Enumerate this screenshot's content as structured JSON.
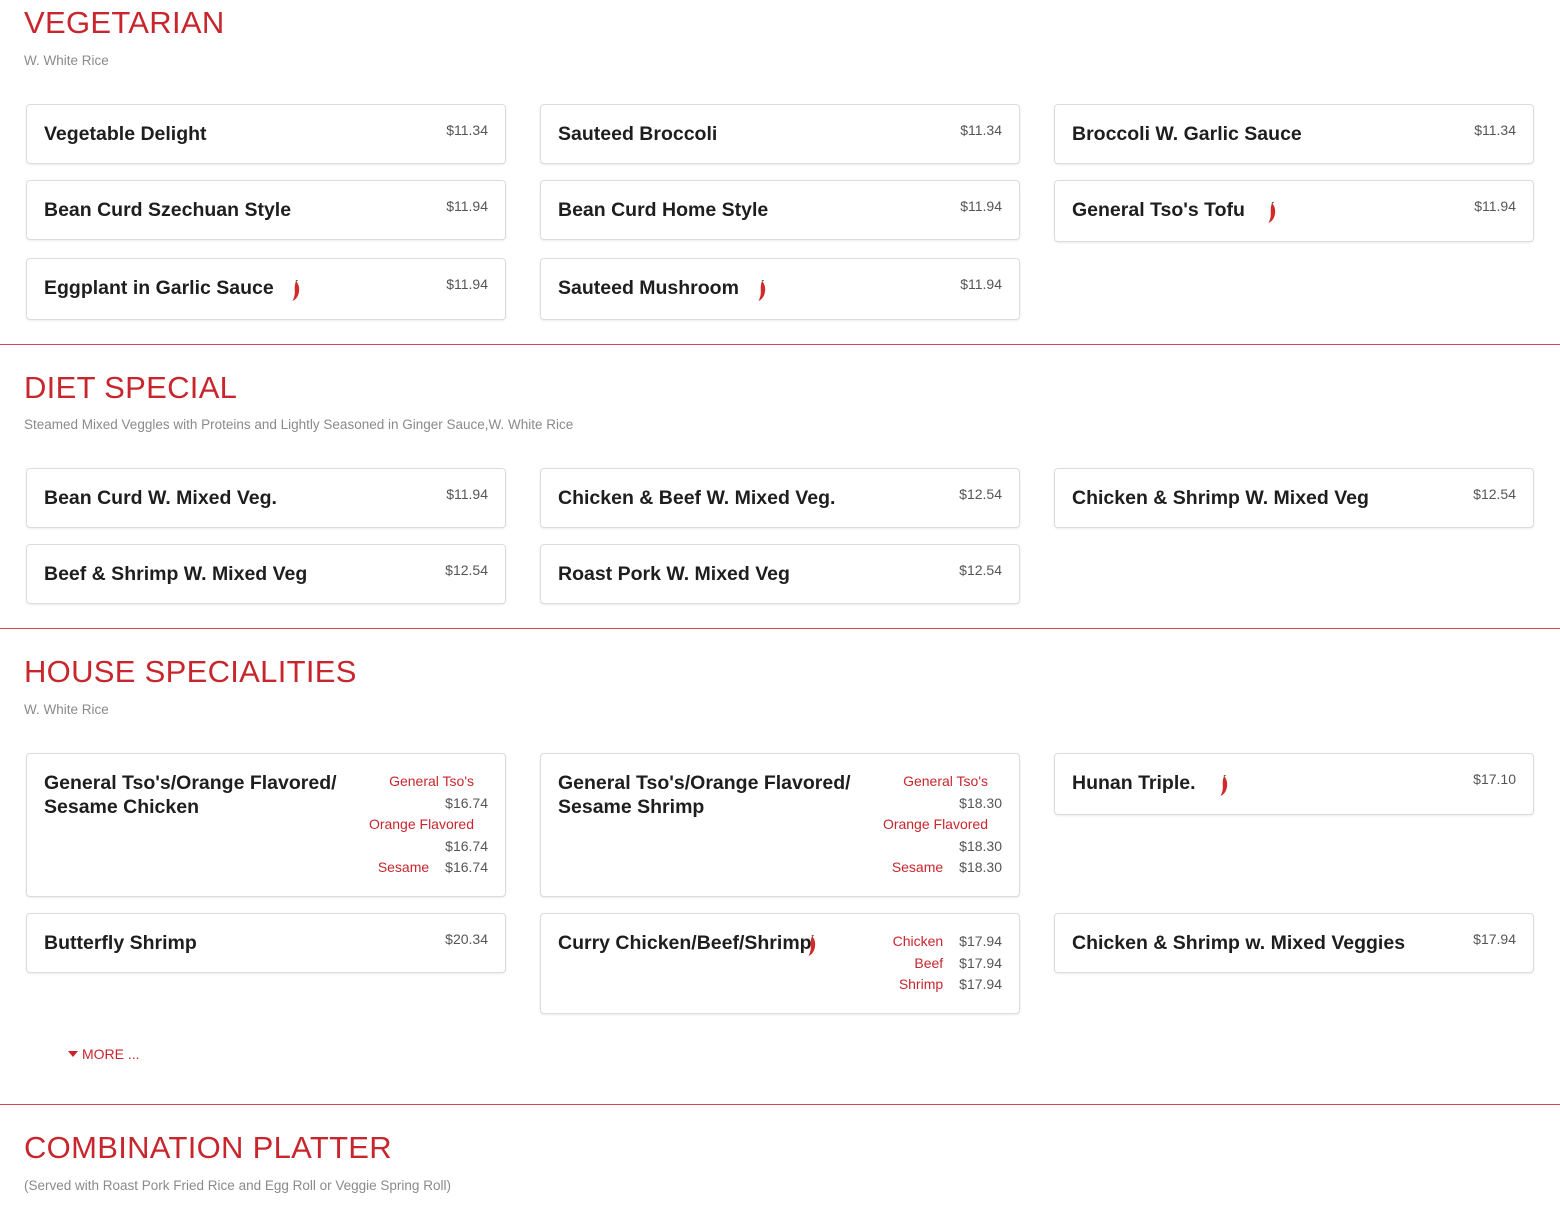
{
  "colors": {
    "accent": "#c8262d",
    "divider": "#d04a50",
    "muted": "#8a8a8a"
  },
  "vegetarian": {
    "title": "VEGETARIAN",
    "subtitle": "W. White Rice",
    "items": [
      {
        "name": "Vegetable Delight",
        "price": "$11.34",
        "spicy": false
      },
      {
        "name": "Sauteed Broccoli",
        "price": "$11.34",
        "spicy": false
      },
      {
        "name": "Broccoli W. Garlic Sauce",
        "price": "$11.34",
        "spicy": false
      },
      {
        "name": "Bean Curd Szechuan Style",
        "price": "$11.94",
        "spicy": false
      },
      {
        "name": "Bean Curd Home Style",
        "price": "$11.94",
        "spicy": false
      },
      {
        "name": "General Tso's Tofu",
        "price": "$11.94",
        "spicy": true
      },
      {
        "name": "Eggplant in Garlic Sauce",
        "price": "$11.94",
        "spicy": true
      },
      {
        "name": "Sauteed Mushroom",
        "price": "$11.94",
        "spicy": true
      }
    ]
  },
  "diet_special": {
    "title": "DIET SPECIAL",
    "subtitle": "Steamed Mixed Veggles with Proteins and Lightly Seasoned in Ginger Sauce,W. White Rice",
    "items": [
      {
        "name": "Bean Curd W. Mixed Veg.",
        "price": "$11.94"
      },
      {
        "name": "Chicken & Beef W. Mixed Veg.",
        "price": "$12.54"
      },
      {
        "name": "Chicken & Shrimp W. Mixed Veg",
        "price": "$12.54"
      },
      {
        "name": "Beef & Shrimp W. Mixed Veg",
        "price": "$12.54"
      },
      {
        "name": "Roast Pork W. Mixed Veg",
        "price": "$12.54"
      }
    ]
  },
  "house_specialities": {
    "title": "HOUSE SPECIALITIES",
    "subtitle": "W. White Rice",
    "items": [
      {
        "name": "General Tso's/Orange Flavored/ Sesame Chicken",
        "options": [
          {
            "label": "General Tso's",
            "price": "$16.74"
          },
          {
            "label": "Orange Flavored",
            "price": "$16.74"
          },
          {
            "label": "Sesame",
            "price": "$16.74"
          }
        ]
      },
      {
        "name": "General Tso's/Orange Flavored/ Sesame Shrimp",
        "options": [
          {
            "label": "General Tso's",
            "price": "$18.30"
          },
          {
            "label": "Orange Flavored",
            "price": "$18.30"
          },
          {
            "label": "Sesame",
            "price": "$18.30"
          }
        ]
      },
      {
        "name": "Hunan Triple.",
        "price": "$17.10",
        "spicy": true
      },
      {
        "name": "Butterfly Shrimp",
        "price": "$20.34"
      },
      {
        "name": "Curry Chicken/Beef/Shrimp",
        "spicy": true,
        "options": [
          {
            "label": "Chicken",
            "price": "$17.94"
          },
          {
            "label": "Beef",
            "price": "$17.94"
          },
          {
            "label": "Shrimp",
            "price": "$17.94"
          }
        ]
      },
      {
        "name": "Chicken & Shrimp w. Mixed Veggies",
        "price": "$17.94"
      }
    ],
    "more_label": "MORE ..."
  },
  "combination_platter": {
    "title": "COMBINATION PLATTER",
    "subtitle": "(Served with Roast Pork Fried Rice and Egg Roll or Veggie Spring Roll)"
  }
}
